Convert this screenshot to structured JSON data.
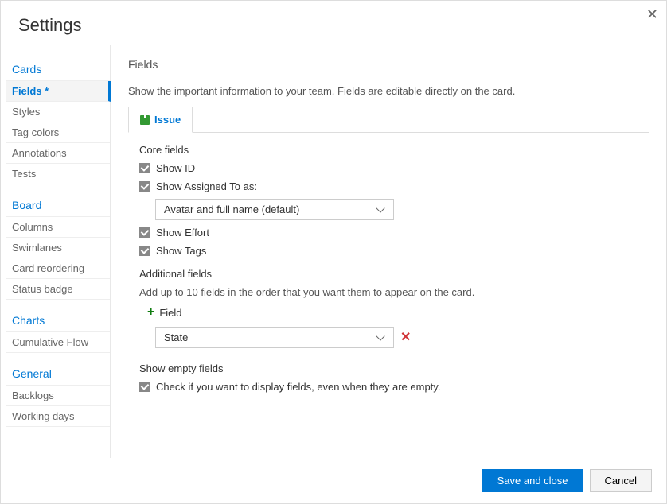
{
  "dialog_title": "Settings",
  "sidebar": {
    "cards": {
      "header": "Cards",
      "items": [
        "Fields *",
        "Styles",
        "Tag colors",
        "Annotations",
        "Tests"
      ]
    },
    "board": {
      "header": "Board",
      "items": [
        "Columns",
        "Swimlanes",
        "Card reordering",
        "Status badge"
      ]
    },
    "charts": {
      "header": "Charts",
      "items": [
        "Cumulative Flow"
      ]
    },
    "general": {
      "header": "General",
      "items": [
        "Backlogs",
        "Working days"
      ]
    }
  },
  "main": {
    "title": "Fields",
    "description": "Show the important information to your team. Fields are editable directly on the card.",
    "tab_label": "Issue",
    "core_fields_label": "Core fields",
    "show_id": "Show ID",
    "show_assigned_to": "Show Assigned To as:",
    "assigned_to_value": "Avatar and full name (default)",
    "show_effort": "Show Effort",
    "show_tags": "Show Tags",
    "additional_fields_label": "Additional fields",
    "additional_fields_desc": "Add up to 10 fields in the order that you want them to appear on the card.",
    "add_field_label": "Field",
    "added_field_value": "State",
    "show_empty_label": "Show empty fields",
    "show_empty_desc": "Check if you want to display fields, even when they are empty."
  },
  "buttons": {
    "save": "Save and close",
    "cancel": "Cancel"
  }
}
